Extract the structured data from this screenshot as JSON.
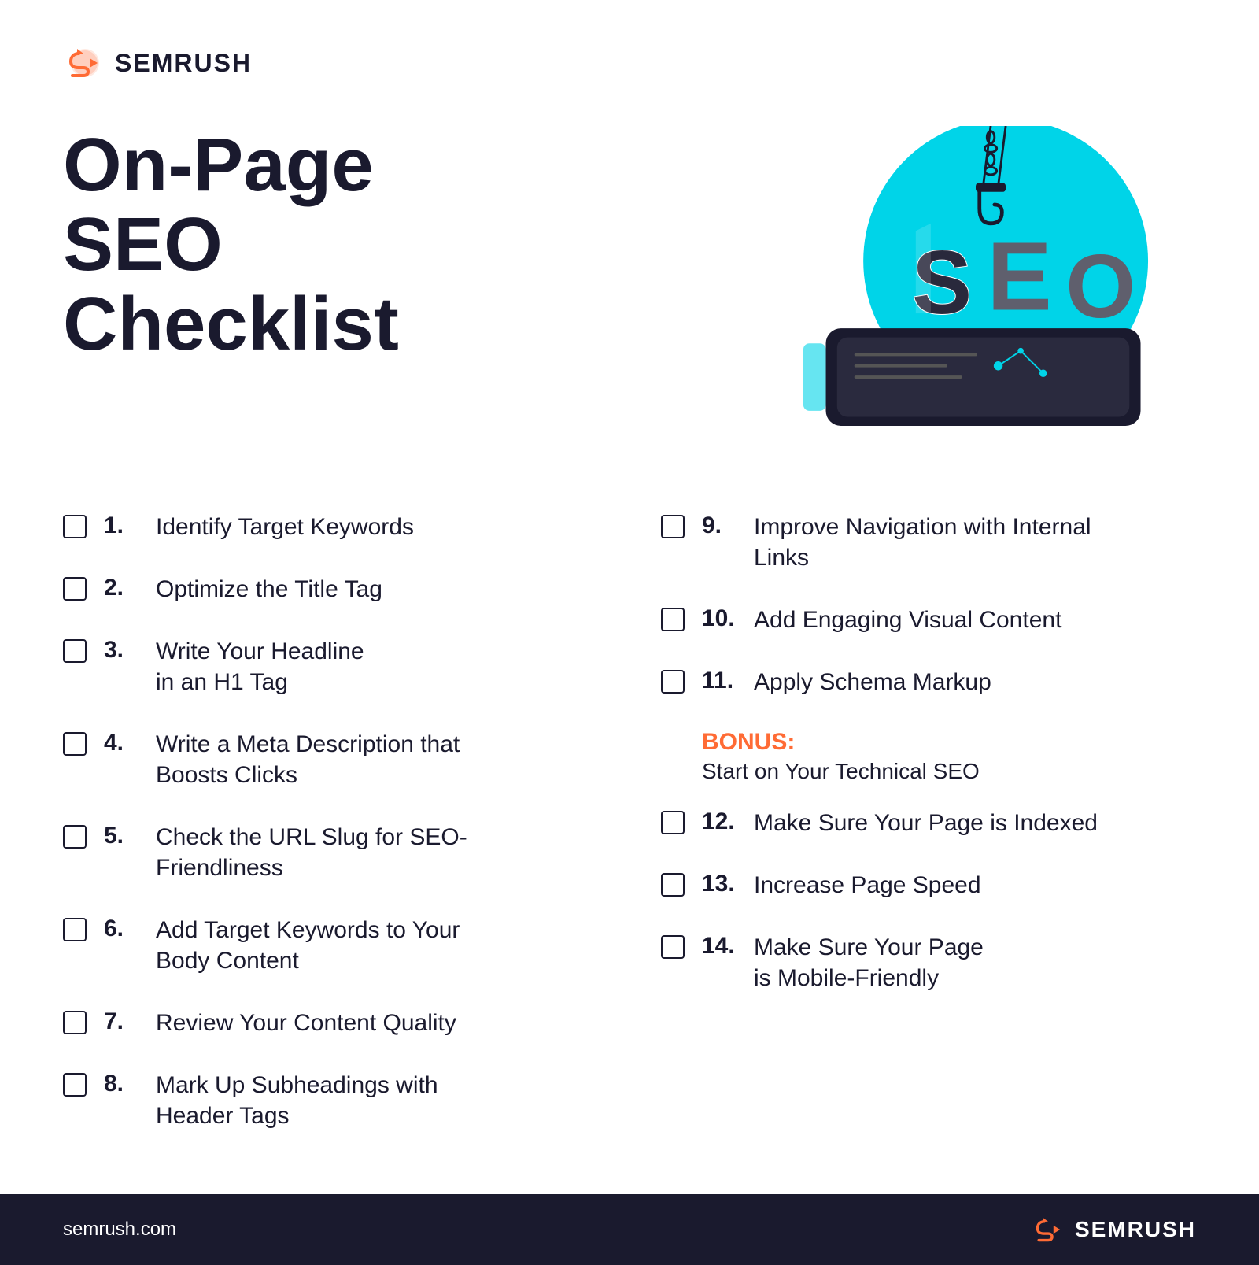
{
  "logo": {
    "text": "SEMRUSH",
    "url_text": "semrush.com"
  },
  "title": {
    "line1": "On-Page SEO",
    "line2": "Checklist"
  },
  "checklist_left": [
    {
      "number": "1.",
      "text": "Identify Target Keywords"
    },
    {
      "number": "2.",
      "text": "Optimize the Title Tag"
    },
    {
      "number": "3.",
      "text": "Write Your Headline\nin an H1 Tag"
    },
    {
      "number": "4.",
      "text": "Write a Meta Description that\nBoosts Clicks"
    },
    {
      "number": "5.",
      "text": "Check the URL Slug for SEO-\nFriendliness"
    },
    {
      "number": "6.",
      "text": "Add Target Keywords to Your\nBody Content"
    },
    {
      "number": "7.",
      "text": "Review Your Content Quality"
    },
    {
      "number": "8.",
      "text": "Mark Up Subheadings with\nHeader Tags"
    }
  ],
  "checklist_right": [
    {
      "number": "9.",
      "text": "Improve Navigation with Internal\nLinks"
    },
    {
      "number": "10.",
      "text": "Add Engaging Visual Content"
    },
    {
      "number": "11.",
      "text": "Apply Schema Markup"
    },
    {
      "number": "12.",
      "text": "Make Sure Your Page is Indexed"
    },
    {
      "number": "13.",
      "text": "Increase Page Speed"
    },
    {
      "number": "14.",
      "text": "Make Sure Your Page\nis Mobile-Friendly"
    }
  ],
  "bonus": {
    "label": "BONUS:",
    "text": "Start on Your Technical SEO"
  },
  "colors": {
    "orange": "#ff6b35",
    "dark": "#1a1a2e",
    "cyan": "#00d4e8",
    "white": "#ffffff"
  }
}
